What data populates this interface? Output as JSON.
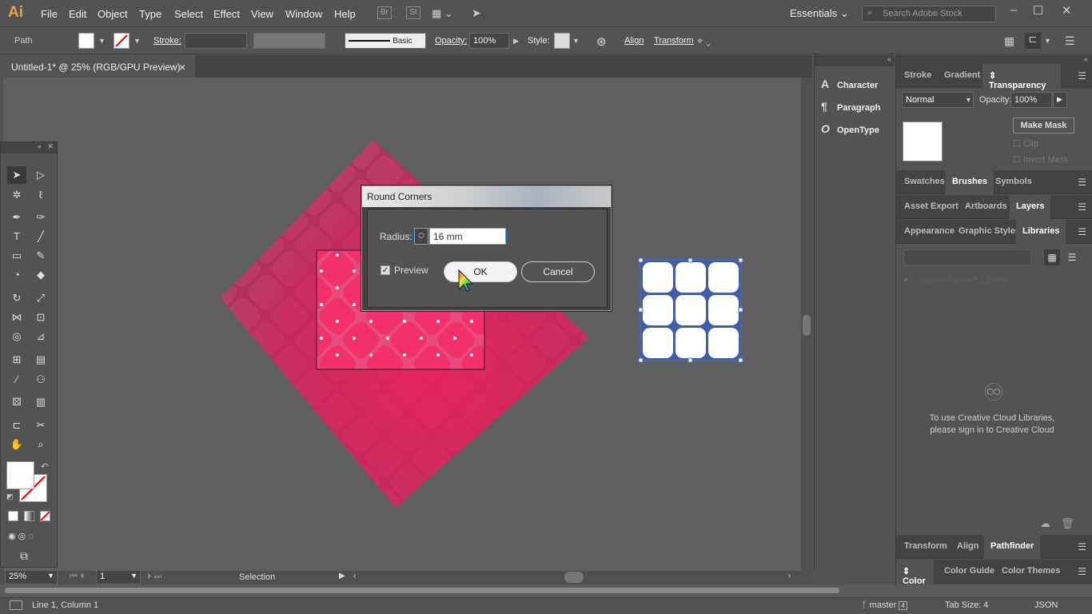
{
  "app": {
    "logo": "Ai",
    "menus": [
      "File",
      "Edit",
      "Object",
      "Type",
      "Select",
      "Effect",
      "View",
      "Window",
      "Help"
    ],
    "bridge_icon": "Br",
    "stock_icon": "St",
    "workspace": "Essentials",
    "search_placeholder": "Search Adobe Stock",
    "win_controls": [
      "–",
      "☐",
      "✕"
    ]
  },
  "control": {
    "object_type": "Path",
    "stroke_label": "Stroke:",
    "brush_label": "Basic",
    "opacity_label": "Opacity:",
    "opacity_value": "100%",
    "style_label": "Style:",
    "align_label": "Align",
    "transform_label": "Transform"
  },
  "document": {
    "tab_title": "Untitled-1* @ 25% (RGB/GPU Preview)",
    "close": "×"
  },
  "bottom": {
    "zoom": "25%",
    "artboard": "1",
    "tool_name": "Selection"
  },
  "statusbar": {
    "position": "Line 1, Column 1",
    "branch": "master",
    "branch_count": "4",
    "tab_size": "Tab Size: 4",
    "language": "JSON"
  },
  "dock": [
    {
      "icon": "A",
      "label": "Character"
    },
    {
      "icon": "¶",
      "label": "Paragraph"
    },
    {
      "icon": "O",
      "label": "OpenType"
    }
  ],
  "panels": {
    "row1": [
      "Stroke",
      "Gradient",
      "Transparency"
    ],
    "transparency": {
      "blend_mode": "Normal",
      "opacity_label": "Opacity:",
      "opacity_value": "100%",
      "make_mask": "Make Mask",
      "clip": "Clip",
      "invert_mask": "Invert Mask"
    },
    "row2": [
      "Swatches",
      "Brushes",
      "Symbols"
    ],
    "row3": [
      "Asset Export",
      "Artboards",
      "Layers"
    ],
    "row4": [
      "Appearance",
      "Graphic Styles",
      "Libraries"
    ],
    "libraries": {
      "search_placeholder": "Search Current Library",
      "message_line1": "To use Creative Cloud Libraries,",
      "message_line2": "please sign in to Creative Cloud"
    },
    "row5": [
      "Transform",
      "Align",
      "Pathfinder"
    ],
    "row6": [
      "Color",
      "Color Guide",
      "Color Themes"
    ]
  },
  "dialog": {
    "title": "Round Corners",
    "radius_label": "Radius:",
    "radius_value": "16 mm",
    "preview_label": "Preview",
    "preview_checked": true,
    "ok": "OK",
    "cancel": "Cancel"
  },
  "colors": {
    "accent_pink": "#ef1f63",
    "selection_blue": "#3b6fd8"
  }
}
